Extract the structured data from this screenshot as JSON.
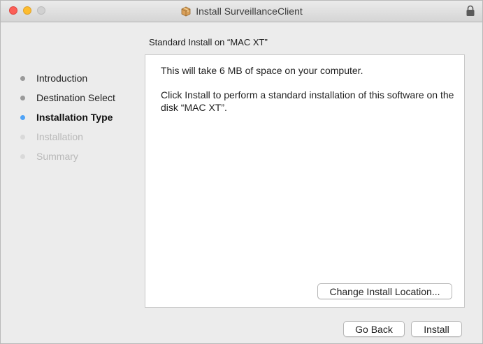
{
  "window": {
    "title": "Install SurveillanceClient"
  },
  "icons": {
    "title_icon": "package-icon",
    "lock": "lock-icon"
  },
  "colors": {
    "current_step_dot": "#4fa3f7",
    "close": "#fc5f57",
    "minimize": "#fdbc2e",
    "zoom_disabled": "#d1d1d1"
  },
  "subheading": "Standard Install on “MAC XT”",
  "sidebar": {
    "steps": [
      {
        "label": "Introduction",
        "state": "done"
      },
      {
        "label": "Destination Select",
        "state": "done"
      },
      {
        "label": "Installation Type",
        "state": "current"
      },
      {
        "label": "Installation",
        "state": "future"
      },
      {
        "label": "Summary",
        "state": "future"
      }
    ]
  },
  "content": {
    "space_text": "This will take 6 MB of space on your computer.",
    "instruction_text": "Click Install to perform a standard installation of this software on the disk “MAC XT”.",
    "change_location_label": "Change Install Location..."
  },
  "footer": {
    "go_back_label": "Go Back",
    "install_label": "Install"
  }
}
